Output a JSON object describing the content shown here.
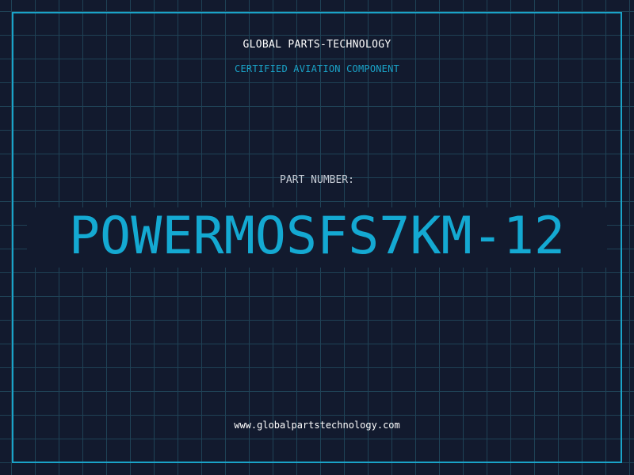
{
  "header": {
    "company": "GLOBAL PARTS-TECHNOLOGY",
    "tagline": "CERTIFIED AVIATION COMPONENT"
  },
  "part": {
    "label": "PART NUMBER:",
    "number": "POWERMOSFS7KM-12"
  },
  "footer": {
    "url": "www.globalpartstechnology.com"
  },
  "colors": {
    "background": "#121a2e",
    "grid": "#1f4256",
    "accent": "#1aa3c8",
    "text": "#ffffff"
  }
}
